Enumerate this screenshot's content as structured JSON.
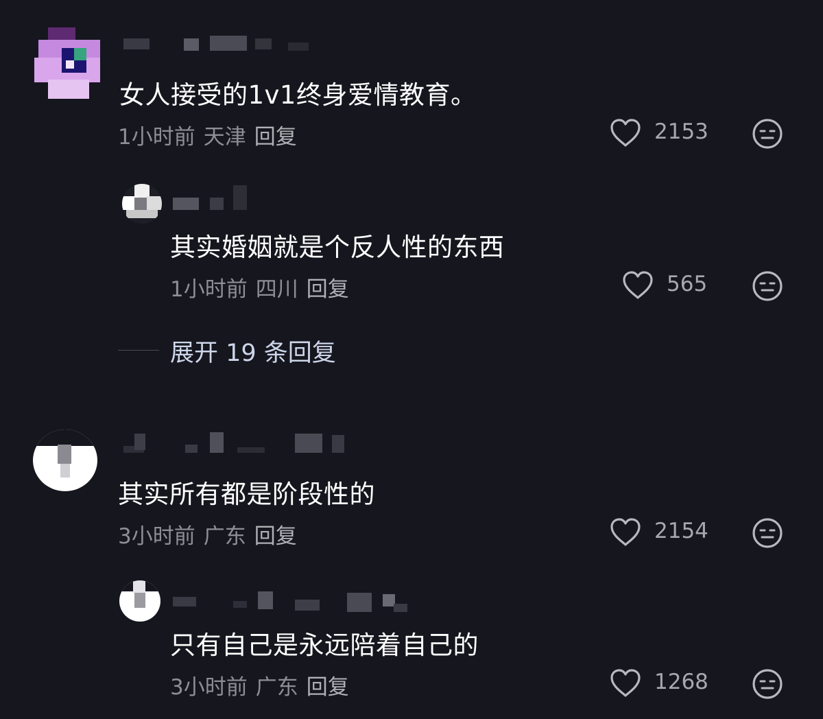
{
  "comments": [
    {
      "text": "女人接受的1v1终身爱情教育。",
      "time": "1小时前",
      "location": "天津",
      "reply_label": "回复",
      "likes": "2153",
      "replies": [
        {
          "text": "其实婚姻就是个反人性的东西",
          "time": "1小时前",
          "location": "四川",
          "reply_label": "回复",
          "likes": "565"
        }
      ],
      "expand_label": "展开 19 条回复"
    },
    {
      "text": "其实所有都是阶段性的",
      "time": "3小时前",
      "location": "广东",
      "reply_label": "回复",
      "likes": "2154",
      "replies": [
        {
          "text": "只有自己是永远陪着自己的",
          "time": "3小时前",
          "location": "广东",
          "reply_label": "回复",
          "likes": "1268"
        }
      ]
    }
  ],
  "icons": {
    "like": "heart-outline-icon",
    "dislike": "neutral-face-icon"
  },
  "colors": {
    "background": "#16161e",
    "text_primary": "#ffffff",
    "text_meta": "#8e8e95",
    "expand_text": "#cdd6ea"
  }
}
